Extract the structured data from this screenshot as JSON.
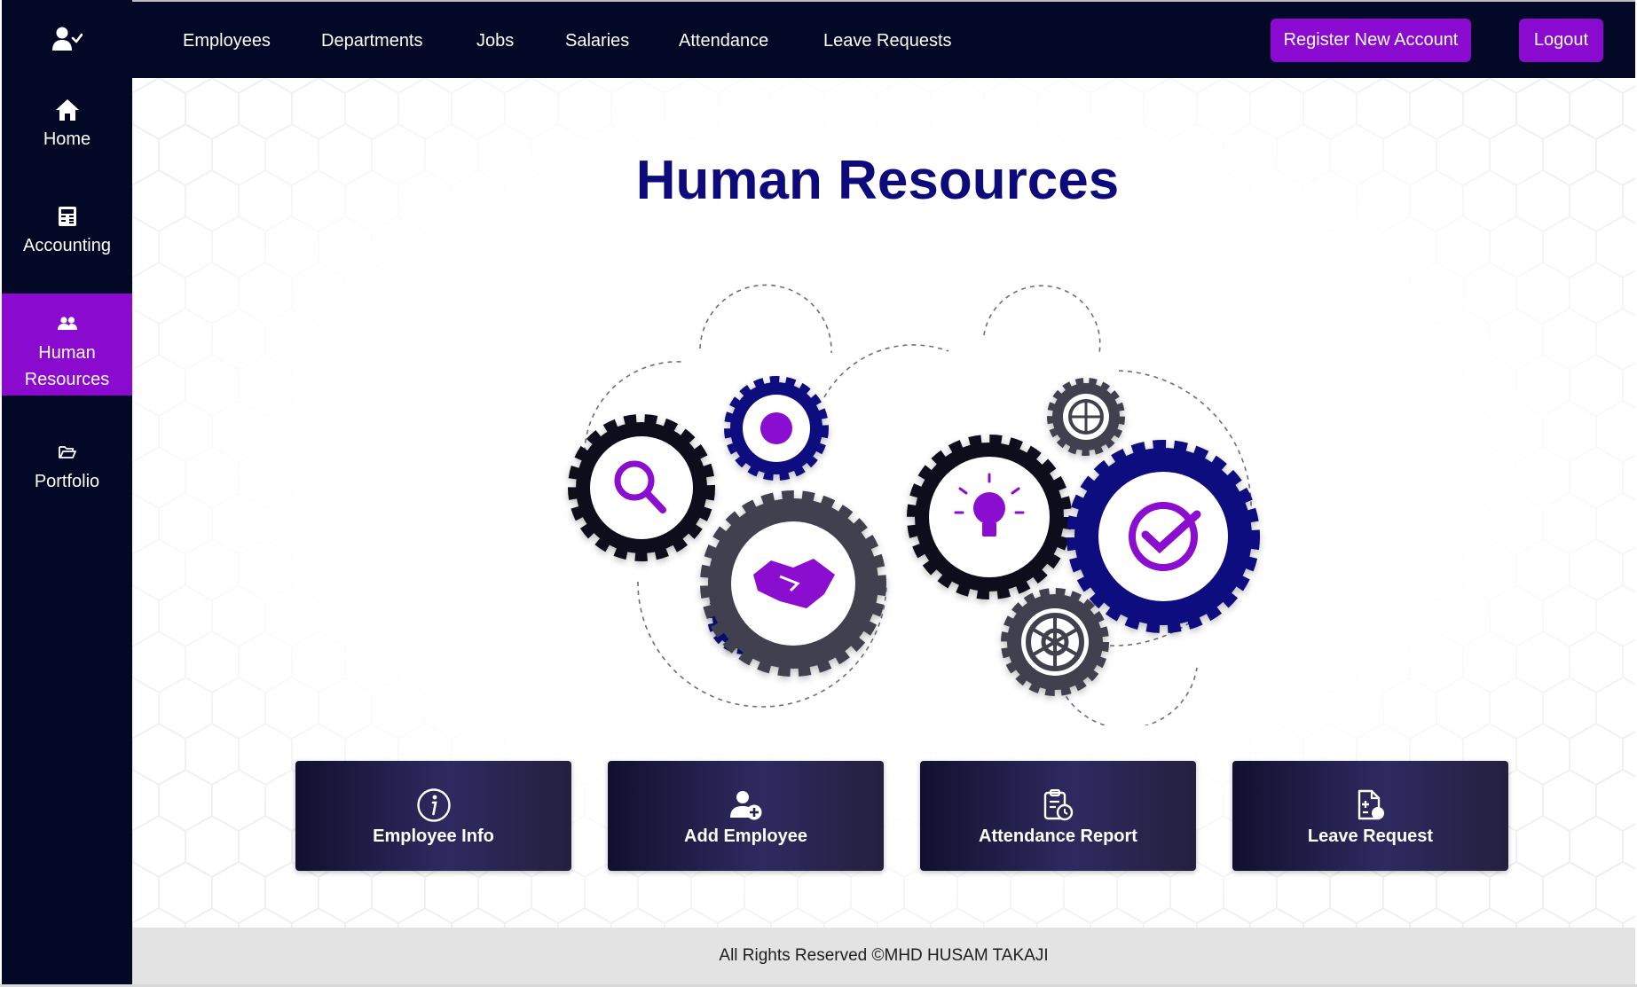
{
  "nav": {
    "links": [
      "Employees",
      "Departments",
      "Jobs",
      "Salaries",
      "Attendance",
      "Leave Requests"
    ],
    "register_label": "Register New Account",
    "logout_label": "Logout"
  },
  "sidebar": {
    "logo_icon": "user-check-icon",
    "items": [
      {
        "label": "Home",
        "icon": "home-icon",
        "active": false
      },
      {
        "label": "Accounting",
        "icon": "calculator-icon",
        "active": false
      },
      {
        "label": "Human Resources",
        "icon": "users-icon",
        "active": true
      },
      {
        "label": "Portfolio",
        "icon": "folder-open-icon",
        "active": false
      }
    ]
  },
  "main": {
    "title": "Human Resources",
    "cards": [
      {
        "label": "Employee Info",
        "icon": "info-icon"
      },
      {
        "label": "Add Employee",
        "icon": "user-plus-icon"
      },
      {
        "label": "Attendance Report",
        "icon": "clipboard-clock-icon"
      },
      {
        "label": "Leave Request",
        "icon": "file-plus-icon"
      }
    ]
  },
  "footer": {
    "text": "All Rights Reserved ©MHD HUSAM TAKAJI"
  },
  "colors": {
    "sidebar_bg": "#030826",
    "accent_purple": "#8a0ad0",
    "title_navy": "#0d0a7c",
    "footer_bg": "#e3e3e3"
  }
}
